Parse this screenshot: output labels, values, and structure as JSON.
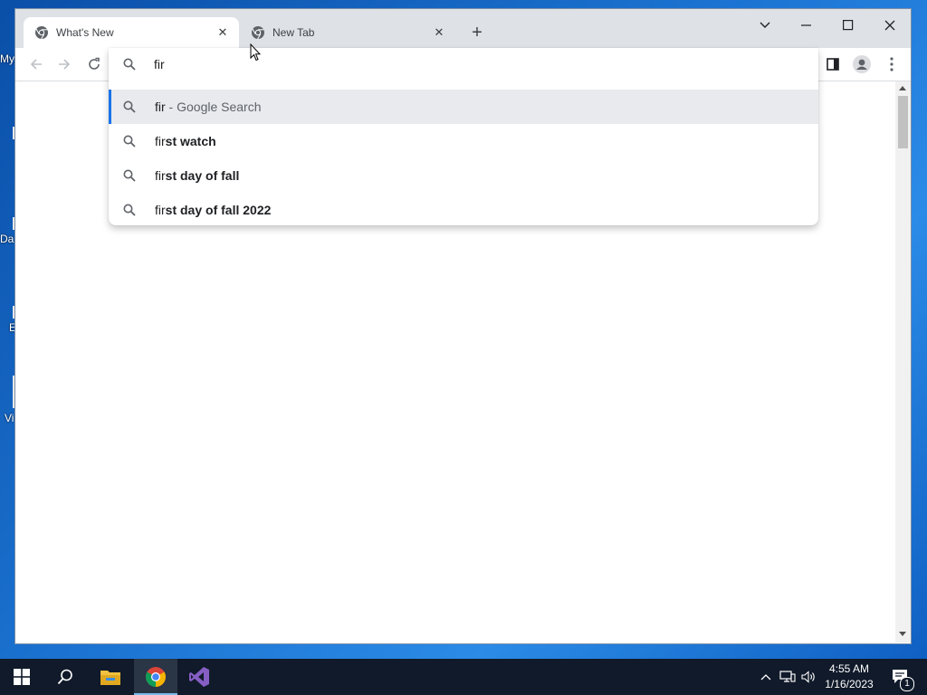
{
  "desktop": {
    "labels": [
      "My",
      "Da",
      "E",
      "Vi"
    ]
  },
  "browser": {
    "tabs": [
      {
        "title": "What's New",
        "active": true
      },
      {
        "title": "New Tab",
        "active": false
      }
    ],
    "window_controls": [
      "chevron-down",
      "minimize",
      "maximize",
      "close"
    ],
    "omnibox": {
      "value": "fir",
      "suggestions": [
        {
          "prefix": "fir",
          "bold": "",
          "suffix": " - Google Search",
          "selected": true
        },
        {
          "prefix": "fir",
          "bold": "st watch",
          "suffix": "",
          "selected": false
        },
        {
          "prefix": "fir",
          "bold": "st day of fall",
          "suffix": "",
          "selected": false
        },
        {
          "prefix": "fir",
          "bold": "st day of fall 2022",
          "suffix": "",
          "selected": false
        }
      ]
    }
  },
  "taskbar": {
    "apps": [
      "start",
      "search",
      "file-explorer",
      "chrome",
      "visual-studio"
    ],
    "clock": {
      "time": "4:55 AM",
      "date": "1/16/2023"
    },
    "notification_count": "1"
  },
  "colors": {
    "accent": "#1a73e8",
    "tabstrip": "#dee1e6",
    "taskbar": "#101a2a"
  }
}
